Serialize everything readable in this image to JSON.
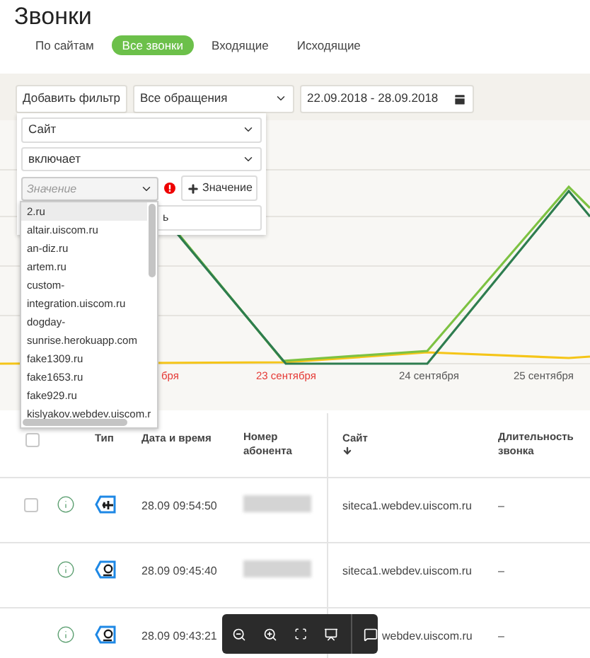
{
  "page": {
    "title": "Звонки"
  },
  "tabs": [
    {
      "label": "По сайтам",
      "selected": false
    },
    {
      "label": "Все звонки",
      "selected": true
    },
    {
      "label": "Входящие",
      "selected": false
    },
    {
      "label": "Исходящие",
      "selected": false
    }
  ],
  "filter_bar": {
    "add_filter_button": "Добавить фильтр",
    "appeal_select": "Все обращения",
    "date_range": "22.09.2018 - 28.09.2018"
  },
  "filter_panel": {
    "field_select": "Сайт",
    "operator_select": "включает",
    "value_input": {
      "placeholder": "Значение"
    },
    "add_value_button": "Значение",
    "hidden_button_text": "ь"
  },
  "value_list": [
    {
      "label": "2.ru",
      "selected": true
    },
    {
      "label": "altair.uiscom.ru",
      "selected": false
    },
    {
      "label": "an-diz.ru",
      "selected": false
    },
    {
      "label": "artem.ru",
      "selected": false
    },
    {
      "label": "custom-integration.uiscom.ru",
      "selected": false
    },
    {
      "label": "dogday-sunrise.herokuapp.com",
      "selected": false
    },
    {
      "label": "fake1309.ru",
      "selected": false
    },
    {
      "label": "fake1653.ru",
      "selected": false
    },
    {
      "label": "fake929.ru",
      "selected": false
    },
    {
      "label": "kislyakov.webdev.uiscom.r",
      "selected": false
    }
  ],
  "chart": {
    "x_labels": [
      {
        "text": "бря",
        "weekend": true
      },
      {
        "text": "23 сентября",
        "weekend": true
      },
      {
        "text": "24 сентября",
        "weekend": false
      },
      {
        "text": "25 сентября",
        "weekend": false
      }
    ]
  },
  "table": {
    "header_checkbox": {
      "checked": false
    },
    "columns": [
      "Тип",
      "Дата и время",
      "Номер абонента",
      "Сайт",
      "Длительность звонка"
    ],
    "rows": [
      {
        "checkbox": {
          "checked": false
        },
        "kind": "transfer",
        "number_redacted": true,
        "time": "28.09 09:54:50",
        "site": "siteca1.webdev.uiscom.ru",
        "duration": "–"
      },
      {
        "kind": "phone",
        "number_redacted": true,
        "time": "28.09 09:45:40",
        "site": "siteca1.webdev.uiscom.ru",
        "duration": "–"
      },
      {
        "kind": "phone",
        "time": "28.09 09:43:21",
        "site": "webdev.uiscom.ru",
        "duration": "–"
      }
    ]
  }
}
